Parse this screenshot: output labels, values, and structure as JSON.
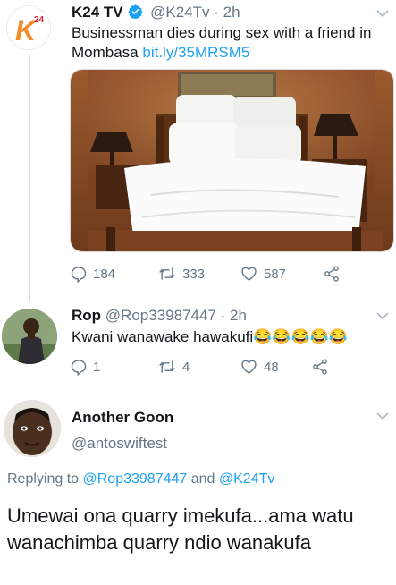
{
  "tweet1": {
    "name": "K24 TV",
    "handle": "@K24Tv",
    "time": "· 2h",
    "text": "Businessman dies during sex with a friend in Mombasa",
    "link": "bit.ly/35MRSM5",
    "replies": "184",
    "retweets": "333",
    "likes": "587",
    "logo_text": "K",
    "logo_sup": "24"
  },
  "tweet2": {
    "name": "Rop",
    "handle": "@Rop33987447",
    "time": "· 2h",
    "text": "Kwani wanawake hawakufi",
    "emoji": "😂😂😂😂😂",
    "replies": "1",
    "retweets": "4",
    "likes": "48"
  },
  "tweet3": {
    "name": "Another Goon",
    "handle": "@antoswiftest",
    "replying_prefix": "Replying to",
    "replying_user1": "@Rop33987447",
    "replying_and": "and",
    "replying_user2": "@K24Tv",
    "text": "Umewai ona quarry  imekufa...ama watu wanachimba quarry ndio wanakufa"
  },
  "colors": {
    "accent": "#1da1f2",
    "secondary_text": "#657786",
    "k24_orange": "#f28c28",
    "k24_red": "#d7262e"
  }
}
